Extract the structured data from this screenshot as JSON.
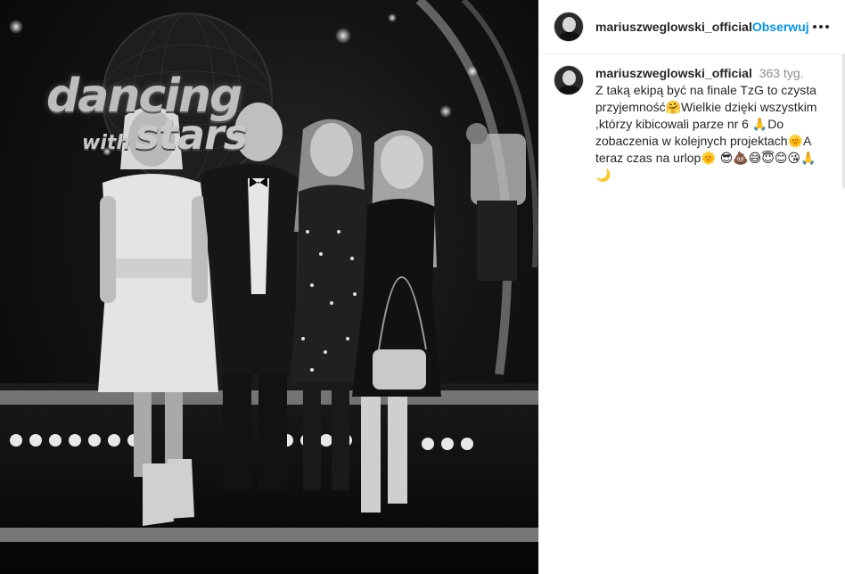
{
  "post": {
    "username": "mariuszweglowski_official",
    "follow_label": "Obserwuj",
    "header_separator": "•",
    "caption": {
      "username": "mariuszweglowski_official",
      "time": "363 tyg.",
      "text": "Z taką ekipą być  na finale TzG to czysta przyjemność🤗Wielkie dzięki wszystkim ,którzy kibicowali parze nr 6 🙏Do zobaczenia w kolejnych projektach🌞A teraz czas na urlop🌞 😎💩😅😇😊😘🙏🌙"
    }
  },
  "photo": {
    "logo_line1": "dancing",
    "logo_with": "with",
    "logo_stars": "stars",
    "colors": {
      "background": "#0b0b0b",
      "stage_light": "#e8e8e8",
      "logo": "#bdbdbd"
    }
  },
  "icons": {
    "more": "more-horizontal-icon",
    "avatar": "profile-avatar-icon"
  }
}
